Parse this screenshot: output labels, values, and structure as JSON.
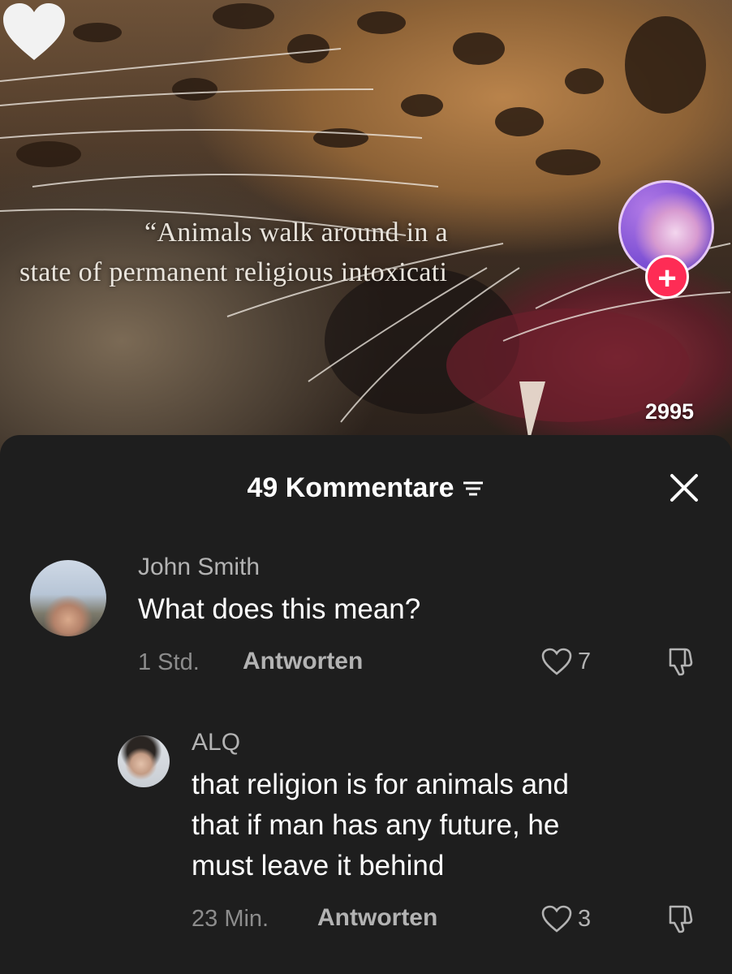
{
  "video": {
    "quote_line1": "“Animals walk around in a",
    "quote_line2": "state of permanent religious intoxicati",
    "like_count": "2995",
    "follow_symbol": "+"
  },
  "comments_sheet": {
    "title": "49 Kommentare",
    "comments": [
      {
        "username": "John Smith",
        "text": "What does this mean?",
        "time": "1 Std.",
        "reply_label": "Antworten",
        "likes": "7"
      }
    ],
    "replies": [
      {
        "username": "ALQ",
        "text_lines": [
          "that religion is for animals and",
          "that if man has any future, he",
          "must leave it behind"
        ],
        "time": "23 Min.",
        "reply_label": "Antworten",
        "likes": "3"
      }
    ]
  },
  "colors": {
    "sheet_background": "#1e1e1e",
    "follow_accent": "#fe2c55",
    "secondary_text": "#b3b3b3"
  },
  "icons": [
    "sort-icon",
    "close-icon",
    "heart-icon",
    "heart-outline-icon",
    "thumbs-down-icon",
    "plus-icon"
  ]
}
